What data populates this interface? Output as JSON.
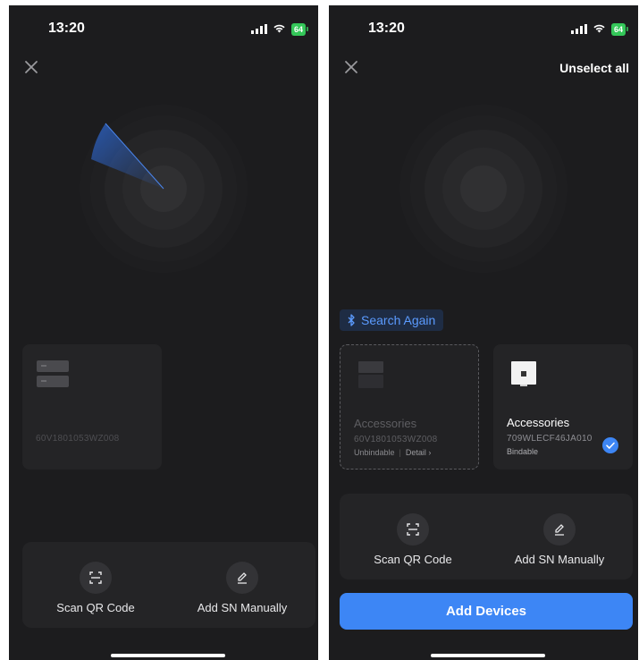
{
  "left_screen": {
    "status": {
      "time": "13:20",
      "battery": "64"
    },
    "device": {
      "sn": "60V1801053WZ008"
    },
    "actions": {
      "scan_label": "Scan QR Code",
      "manual_label": "Add SN Manually"
    }
  },
  "right_screen": {
    "status": {
      "time": "13:20",
      "battery": "64"
    },
    "header": {
      "unselect_all": "Unselect all"
    },
    "search_again": "Search Again",
    "devices": [
      {
        "name": "Accessories",
        "sn": "60V1801053WZ008",
        "status": "Unbindable",
        "detail": "Detail ›"
      },
      {
        "name": "Accessories",
        "sn": "709WLECF46JA010",
        "status": "Bindable",
        "selected": true
      }
    ],
    "actions": {
      "scan_label": "Scan QR Code",
      "manual_label": "Add SN Manually"
    },
    "add_devices": "Add Devices"
  },
  "colors": {
    "background": "#1c1c1e",
    "card": "#242426",
    "accent": "#3d86f5",
    "search_text": "#5b9bff",
    "battery": "#34c759"
  },
  "icons": [
    "close-icon",
    "signal-icon",
    "wifi-icon",
    "battery-icon",
    "radar-icon",
    "bluetooth-icon",
    "device-icon",
    "qr-scan-icon",
    "edit-icon",
    "check-icon"
  ]
}
